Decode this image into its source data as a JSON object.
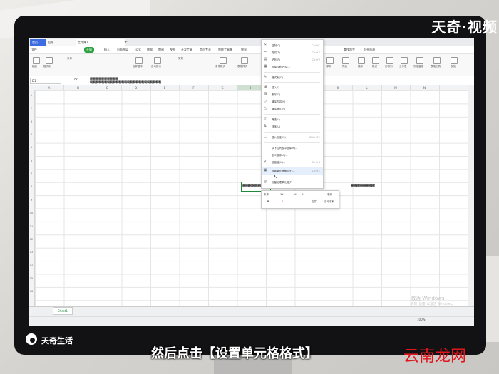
{
  "overlay": {
    "brand_top": "天奇·视频",
    "brand_logo": "天奇生活",
    "subtitle": "然后点击【设置单元格格式】",
    "site_watermark": "云南龙网",
    "accent_red": "#e0161c"
  },
  "app": {
    "tabs": {
      "home": "首页",
      "doc": "稻壳",
      "active": "工作簿1"
    },
    "tab_plus": "+",
    "menu": [
      "文件",
      "开始",
      "插入",
      "页面布局",
      "公式",
      "数据",
      "审阅",
      "视图",
      "开发工具",
      "会员专享",
      "智能工具箱",
      "效率",
      "查找命令",
      "稻壳资源"
    ],
    "ribbon_labels": [
      "粘贴",
      "格式刷",
      "宋体",
      "合并居中",
      "自动换行",
      "常规",
      "条件格式",
      "表格样式",
      "求和",
      "筛选",
      "排序",
      "格式",
      "行和列",
      "工作表",
      "冻结窗格",
      "表格工具",
      "查找"
    ],
    "namebox": "D1",
    "fx": "fx",
    "formula_lines": [
      "啊啊啊啊啊啊啊啊啊啊",
      "啊啊啊啊啊啊啊啊啊啊啊啊啊啊啊啊啊啊啊啊啊啊啊啊啊"
    ],
    "columns": [
      "A",
      "B",
      "C",
      "D",
      "E",
      "F",
      "G",
      "H",
      "I",
      "J",
      "K",
      "L",
      "M",
      "N"
    ],
    "rows": [
      "1",
      "2",
      "3",
      "4",
      "5",
      "6",
      "7",
      "8",
      "9",
      "10",
      "11",
      "12",
      "13",
      "14",
      "15",
      "16"
    ],
    "cell_text": "啊啊啊啊啊啊啊",
    "cell_text_right": "啊啊啊啊啊啊啊啊",
    "sheet_tab": "Sheet1",
    "zoom": "100%",
    "watermark": [
      "激活 Windows",
      "转到“设置”以激活 Windows。"
    ],
    "green": "#2fa343"
  },
  "context_menu": {
    "items": [
      {
        "icon": "copy-icon",
        "glyph": "⎘",
        "label": "复制(C)",
        "shortcut": "Ctrl+C"
      },
      {
        "icon": "cut-icon",
        "glyph": "✂",
        "label": "剪切(T)",
        "shortcut": "Ctrl+X"
      },
      {
        "icon": "paste-icon",
        "glyph": "▤",
        "label": "粘贴(P)",
        "shortcut": "Ctrl+V"
      },
      {
        "icon": "paste-special-icon",
        "glyph": "▦",
        "label": "选择性粘贴(S)...",
        "shortcut": ""
      },
      {
        "icon": "format-painter-icon",
        "glyph": "✎",
        "label": "格式刷(O)",
        "shortcut": ""
      },
      {
        "icon": "insert-icon",
        "glyph": "⊞",
        "label": "插入(I)",
        "shortcut": ""
      },
      {
        "icon": "delete-icon",
        "glyph": "⊟",
        "label": "删除(D)",
        "shortcut": ""
      },
      {
        "icon": "clear-icon",
        "glyph": "◇",
        "label": "清除内容(N)",
        "shortcut": ""
      },
      {
        "icon": "clear-all-icon",
        "glyph": "△",
        "label": "清除格式(F)",
        "shortcut": ""
      },
      {
        "icon": "filter-icon",
        "glyph": "▽",
        "label": "筛选(L)",
        "shortcut": ""
      },
      {
        "icon": "sort-icon",
        "glyph": "⇅",
        "label": "排序(U)",
        "shortcut": ""
      },
      {
        "icon": "comment-icon",
        "glyph": "▢",
        "label": "插入批注(M)",
        "shortcut": "Shift+F2"
      },
      {
        "icon": "picklist-icon",
        "glyph": "",
        "label": "从下拉列表中选择(K)...",
        "shortcut": ""
      },
      {
        "icon": "define-name-icon",
        "glyph": "",
        "label": "定义名称(A)...",
        "shortcut": ""
      },
      {
        "icon": "hyperlink-icon",
        "glyph": "⚲",
        "label": "超链接(H)...",
        "shortcut": "Ctrl+K"
      },
      {
        "icon": "format-cells-icon",
        "glyph": "▣",
        "label": "设置单元格格式(F)...",
        "shortcut": "Ctrl+1"
      },
      {
        "icon": "batch-icon",
        "glyph": "◎",
        "label": "批量处理单元格(P)",
        "shortcut": ""
      }
    ],
    "mini_toolbar": [
      "宋体",
      "11",
      "A⁺",
      "A⁻",
      "合并",
      "求和",
      "B",
      "A",
      "自动求和"
    ]
  }
}
